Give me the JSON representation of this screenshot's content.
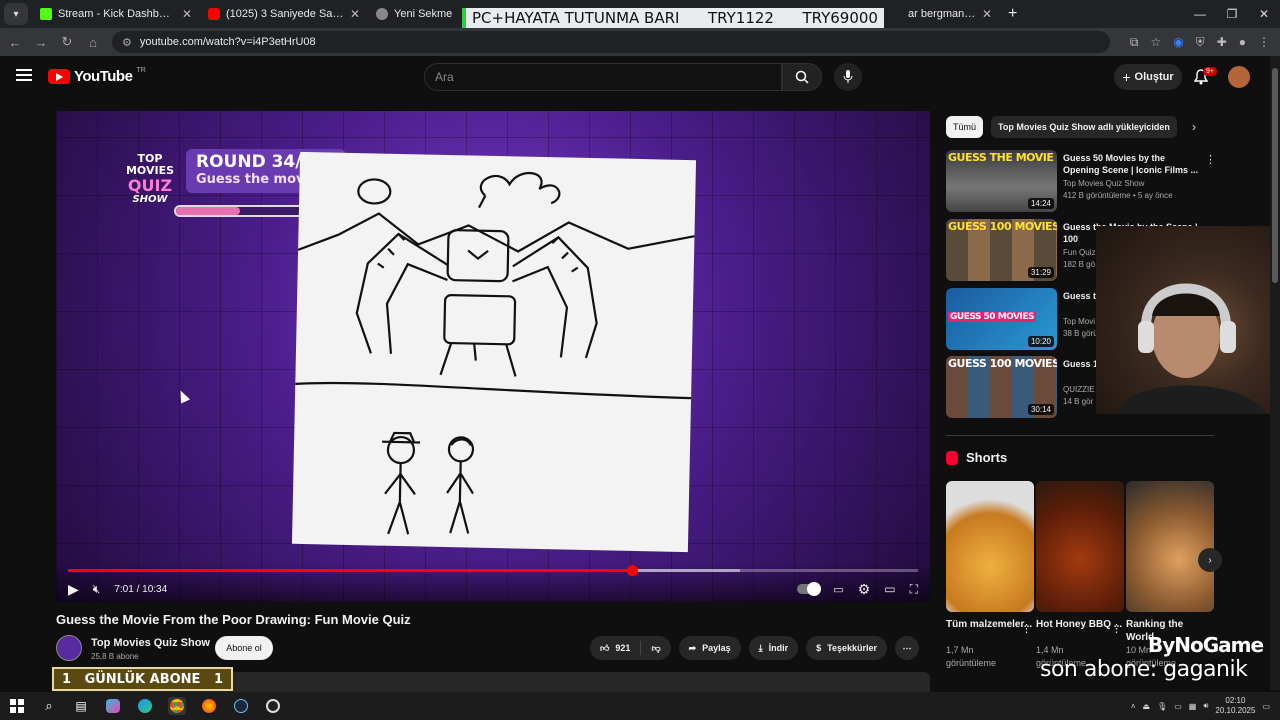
{
  "browser": {
    "tabs": [
      {
        "label": "Stream - Kick Dashboard",
        "color": "#53fc18"
      },
      {
        "label": "(1025) 3 Saniyede Sahneye Gör",
        "color": "#ff0000"
      },
      {
        "label": "Yeni Sekme",
        "color": "#888888"
      }
    ],
    "tab_last": "ar bergman death",
    "url": "youtube.com/watch?v=i4P3etHrU08"
  },
  "overlay": {
    "left": "PC+HAYATA TUTUNMA BARI",
    "mid": "TRY1122",
    "right": "TRY69000"
  },
  "youtube": {
    "logo": "YouTube",
    "country": "TR",
    "search_placeholder": "Ara",
    "create": "Oluştur",
    "notif_count": "9+"
  },
  "player": {
    "round": "ROUND 34/50",
    "subtitle": "Guess the movie",
    "quiz_logo": [
      "TOP MOVIES",
      "QUIZ",
      "SHOW"
    ],
    "time": "7:01 / 10:34",
    "progress": 0.664,
    "loaded": 0.79
  },
  "video": {
    "title": "Guess the Movie From the Poor Drawing: Fun Movie Quiz",
    "channel": "Top Movies Quiz Show",
    "subs": "25,8 B abone",
    "subscribe": "Abone ol",
    "likes": "921",
    "share": "Paylaş",
    "download": "İndir",
    "thanks": "Teşekkürler"
  },
  "stream_overlay": {
    "left": "1",
    "label": "GÜNLÜK ABONE",
    "right": "1"
  },
  "sidebar": {
    "chips": [
      "Tümü",
      "Top Movies Quiz Show adlı yükleyiciden"
    ],
    "recs": [
      {
        "thumb_text": "GUESS THE MOVIE",
        "duration": "14:24",
        "title": "Guess 50 Movies by the Opening Scene | Iconic Films ...",
        "channel": "Top Movies Quiz Show",
        "meta": "412 B görüntüleme • 5 ay önce"
      },
      {
        "thumb_text": "GUESS 100 MOVIES",
        "duration": "31:29",
        "title": "Guess the Movie by the Scene | 100",
        "channel": "Fun Quiz",
        "meta": "182 B gö"
      },
      {
        "thumb_text": "GUESS 50 MOVIES",
        "duration": "10:20",
        "title": "Guess the Movie Drawing",
        "channel": "Top Movi",
        "meta": "38 B görü"
      },
      {
        "thumb_text": "GUESS 100 MOVIES",
        "duration": "30:14",
        "title": "Guess 1 Scene!",
        "channel": "QUIZZIE",
        "meta": "14 B gör"
      }
    ],
    "shorts_title": "Shorts",
    "shorts": [
      {
        "title": "Tüm malzemeler...",
        "views": "1,7 Mn",
        "views2": "görüntüleme"
      },
      {
        "title": "Hot Honey BBQ ...",
        "views": "1,4 Mn",
        "views2": "görüntüleme"
      },
      {
        "title": "Ranking the World",
        "views": "10 Mn",
        "views2": "görüntüleme"
      }
    ]
  },
  "watermark": {
    "logo": "ByNoGame",
    "abone": "son abone: gaganik"
  },
  "taskbar": {
    "time": "02:10",
    "date": "20.10.2025"
  }
}
